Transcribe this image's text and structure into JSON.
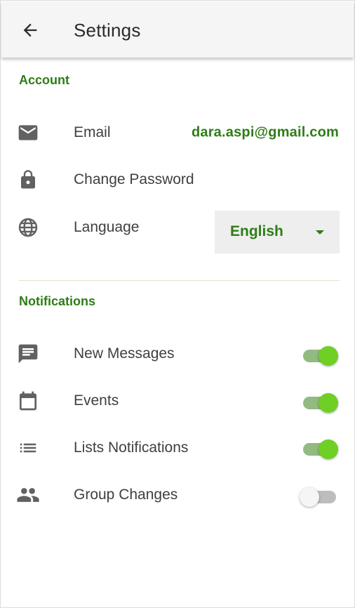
{
  "appbar": {
    "title": "Settings",
    "back_icon": "arrow-left-icon"
  },
  "account": {
    "header": "Account",
    "email": {
      "label": "Email",
      "value": "dara.aspi@gmail.com",
      "icon": "mail-icon"
    },
    "password": {
      "label": "Change Password",
      "icon": "lock-icon"
    },
    "language": {
      "label": "Language",
      "value": "English",
      "icon": "globe-icon"
    }
  },
  "notifications": {
    "header": "Notifications",
    "items": [
      {
        "label": "New Messages",
        "enabled": true,
        "icon": "message-icon"
      },
      {
        "label": "Events",
        "enabled": true,
        "icon": "calendar-icon"
      },
      {
        "label": "Lists Notifications",
        "enabled": true,
        "icon": "list-icon"
      },
      {
        "label": "Group Changes",
        "enabled": false,
        "icon": "group-icon"
      }
    ]
  },
  "colors": {
    "accent": "#2e7d16",
    "toggle_on_thumb": "#6fcf24",
    "toggle_on_track": "#93ba80",
    "toggle_off_track": "#bdbdbd",
    "icon": "#616161"
  }
}
